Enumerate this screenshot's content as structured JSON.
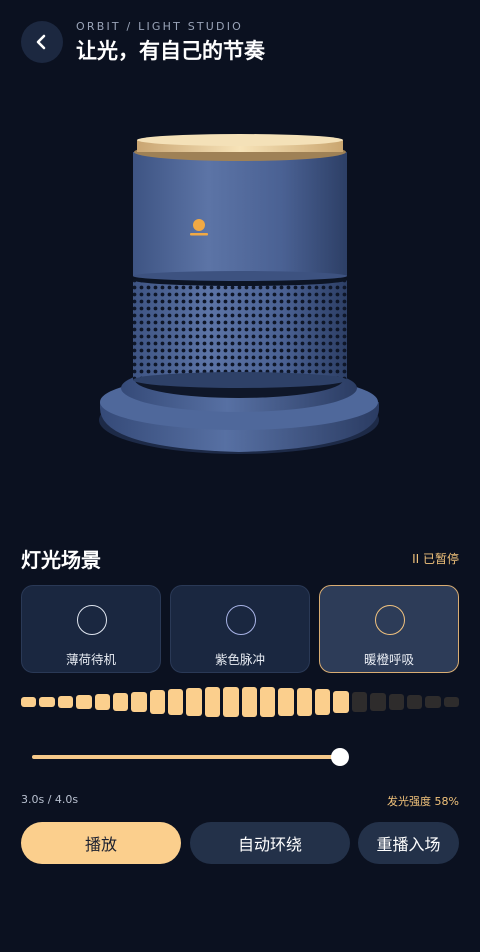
{
  "header": {
    "subtitle": "ORBIT / LIGHT STUDIO",
    "title": "让光，有自己的节奏"
  },
  "scenes": {
    "title": "灯光场景",
    "status": "II 已暂停",
    "items": [
      {
        "label": "薄荷待机",
        "active": false
      },
      {
        "label": "紫色脉冲",
        "active": false
      },
      {
        "label": "暖橙呼吸",
        "active": true
      }
    ]
  },
  "equalizer": {
    "levels": [
      0.28,
      0.3,
      0.33,
      0.37,
      0.42,
      0.48,
      0.55,
      0.64,
      0.72,
      0.78,
      0.82,
      0.85,
      0.85,
      0.83,
      0.8,
      0.76,
      0.7,
      0.62,
      0.55,
      0.48,
      0.42,
      0.37,
      0.32,
      0.28
    ],
    "active_count": 18,
    "active_color": "#fbcf8d",
    "inactive_color": "#2e2c2c"
  },
  "playback": {
    "progress": 0.75,
    "time": "3.0s / 4.0s",
    "intensity": "发光强度 58%"
  },
  "buttons": {
    "play": "播放",
    "orbit": "自动环绕",
    "replay": "重播入场"
  },
  "colors": {
    "accent": "#fbcf8d",
    "background": "#0b1120",
    "card": "#1a2740"
  }
}
